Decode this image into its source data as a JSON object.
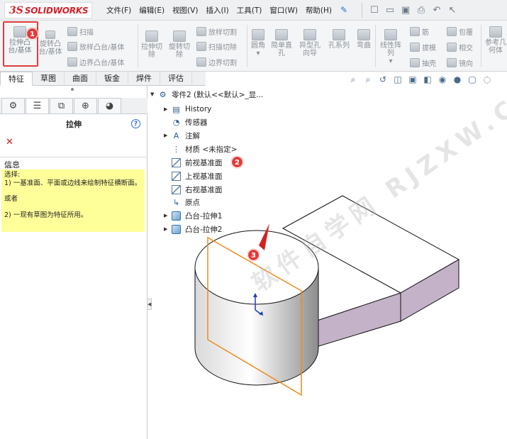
{
  "app": {
    "logo_mark": "3S",
    "logo_text": "SOLIDWORKS",
    "accent_color": "#d4202a"
  },
  "menus": [
    "文件(F)",
    "编辑(E)",
    "视图(V)",
    "插入(I)",
    "工具(T)",
    "窗口(W)",
    "帮助(H)"
  ],
  "ribbon": {
    "extrude_boss": [
      "拉伸凸",
      "台/基体"
    ],
    "revolve_boss": [
      "旋转凸",
      "台/基体"
    ],
    "sweep": "扫描",
    "loft_boss": "放样凸台/基体",
    "boundary_boss": "边界凸台/基体",
    "extrude_cut": [
      "拉伸切",
      "除"
    ],
    "revolve_cut": [
      "旋转切",
      "除"
    ],
    "loft_cut": "放样切割",
    "sweep_cut": "扫描切除",
    "boundary_cut": "边界切割",
    "fillet": "圆角",
    "simple_hole": [
      "简单直",
      "孔"
    ],
    "hole_wizard": [
      "异型孔",
      "向导"
    ],
    "hole_series": "孔系列",
    "bend": "弯曲",
    "linear_pattern": [
      "线性阵",
      "列"
    ],
    "rib": "筋",
    "draft": "拔模",
    "shell": "抽壳",
    "wrap": "包覆",
    "intersect": "相交",
    "mirror": "镜向",
    "ref_geometry": [
      "参考几",
      "何体"
    ]
  },
  "tabs": [
    "特征",
    "草图",
    "曲面",
    "钣金",
    "焊件",
    "评估"
  ],
  "property_manager": {
    "title": "拉伸",
    "help": "?",
    "close": "✕",
    "info_label": "信息",
    "info_lines": [
      "选择:",
      "1) 一基准面、平面或边线来绘制特征横断面。",
      "",
      "或者",
      "",
      "2) 一现有草图为特征所用。"
    ]
  },
  "tree": {
    "root": "零件2 (默认<<默认>_显...",
    "items": [
      "History",
      "传感器",
      "注解",
      "材质 <未指定>",
      "前视基准面",
      "上视基准面",
      "右视基准面",
      "原点",
      "凸台-拉伸1",
      "凸台-拉伸2"
    ]
  },
  "markers": [
    "1",
    "2",
    "3"
  ],
  "watermark": "软件自学网 RJZXW.COM",
  "colors": {
    "highlight": "#e23b3b",
    "plane": "#f08a1c",
    "info_bg": "#ffff99",
    "bar_side": "#c4b2c8"
  }
}
